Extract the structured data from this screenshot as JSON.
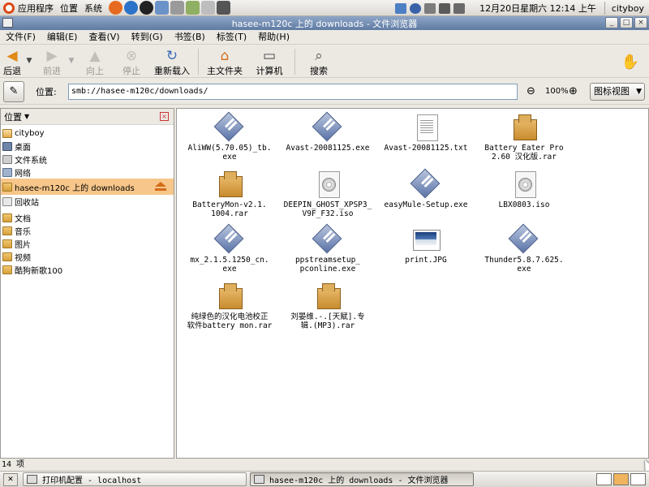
{
  "top_panel": {
    "menus": [
      "应用程序",
      "位置",
      "系统"
    ],
    "launchers": [
      {
        "name": "firefox-icon",
        "color": "#e66a1f"
      },
      {
        "name": "kde-icon",
        "color": "#2a73c8"
      },
      {
        "name": "qq-icon",
        "color": "#222222"
      },
      {
        "name": "virtualbox-icon",
        "color": "#6b92c9"
      },
      {
        "name": "people-icon",
        "color": "#9a9a9a"
      },
      {
        "name": "pidgin-icon",
        "color": "#8fb062"
      },
      {
        "name": "text-editor-icon",
        "color": "#bdbdbd"
      },
      {
        "name": "camera-icon",
        "color": "#555555"
      }
    ],
    "clock": "12月20日星期六  12:14 上午",
    "user": "cityboy"
  },
  "window": {
    "title": "hasee-m120c 上的 downloads - 文件浏览器",
    "menus": [
      "文件(F)",
      "编辑(E)",
      "查看(V)",
      "转到(G)",
      "书签(B)",
      "标签(T)",
      "帮助(H)"
    ]
  },
  "toolbar": {
    "back": "后退",
    "forward": "前进",
    "up": "向上",
    "stop": "停止",
    "reload": "重新载入",
    "home": "主文件夹",
    "computer": "计算机",
    "search": "搜索"
  },
  "location": {
    "label": "位置:",
    "path": "smb://hasee-m120c/downloads/",
    "zoom": "100%",
    "view_mode": "图标视图"
  },
  "sidebar": {
    "title": "位置",
    "groups": [
      [
        {
          "label": "cityboy",
          "icon": "home"
        },
        {
          "label": "桌面",
          "icon": "desk"
        },
        {
          "label": "文件系统",
          "icon": "disk"
        },
        {
          "label": "网络",
          "icon": "net"
        },
        {
          "label": "hasee-m120c 上的 downloads",
          "icon": "share",
          "selected": true
        },
        {
          "label": "回收站",
          "icon": "trash"
        }
      ],
      [
        {
          "label": "文档",
          "icon": "folder"
        },
        {
          "label": "音乐",
          "icon": "folder"
        },
        {
          "label": "图片",
          "icon": "folder"
        },
        {
          "label": "视频",
          "icon": "folder"
        },
        {
          "label": "酷狗新歌100",
          "icon": "folder"
        }
      ]
    ]
  },
  "files": [
    {
      "name": "AliWW(5.70.05)_tb.exe",
      "lines": [
        "AliWW(5.70.05)_tb.",
        "exe"
      ],
      "type": "exe"
    },
    {
      "name": "Avast-20081125.exe",
      "lines": [
        "Avast-20081125.exe"
      ],
      "type": "exe"
    },
    {
      "name": "Avast-20081125.txt",
      "lines": [
        "Avast-20081125.txt"
      ],
      "type": "txt"
    },
    {
      "name": "Battery Eater Pro 2.60 汉化版.rar",
      "lines": [
        "Battery Eater Pro",
        "2.60 汉化版.rar"
      ],
      "type": "rar"
    },
    {
      "name": "BatteryMon-v2.1.1004.rar",
      "lines": [
        "BatteryMon-v2.1.",
        "1004.rar"
      ],
      "type": "rar"
    },
    {
      "name": "DEEPIN_GHOST_XPSP3_V9F_F32.iso",
      "lines": [
        "DEEPIN_GHOST_XPSP3_",
        "V9F_F32.iso"
      ],
      "type": "iso"
    },
    {
      "name": "easyMule-Setup.exe",
      "lines": [
        "easyMule-Setup.exe"
      ],
      "type": "exe"
    },
    {
      "name": "LBX0803.iso",
      "lines": [
        "LBX0803.iso"
      ],
      "type": "iso"
    },
    {
      "name": "mx_2.1.5.1250_cn.exe",
      "lines": [
        "mx_2.1.5.1250_cn.",
        "exe"
      ],
      "type": "exe"
    },
    {
      "name": "ppstreamsetup_pconline.exe",
      "lines": [
        "ppstreamsetup_",
        "pconline.exe"
      ],
      "type": "exe"
    },
    {
      "name": "print.JPG",
      "lines": [
        "print.JPG"
      ],
      "type": "jpg"
    },
    {
      "name": "Thunder5.8.7.625.exe",
      "lines": [
        "Thunder5.8.7.625.",
        "exe"
      ],
      "type": "exe"
    },
    {
      "name": "纯绿色的汉化电池校正软件battery mon.rar",
      "lines": [
        "纯绿色的汉化电池校正",
        "软件battery mon.rar"
      ],
      "type": "rar"
    },
    {
      "name": "刘晏维.-.[天赋].专辑.(MP3).rar",
      "lines": [
        "刘晏维.-.[天赋].专",
        "辑.(MP3).rar"
      ],
      "type": "rar"
    }
  ],
  "status": "14 项",
  "taskbar": {
    "tasks": [
      {
        "label": "打印机配置 - localhost",
        "active": false
      },
      {
        "label": "hasee-m120c 上的 downloads - 文件浏览器",
        "active": true
      }
    ]
  }
}
